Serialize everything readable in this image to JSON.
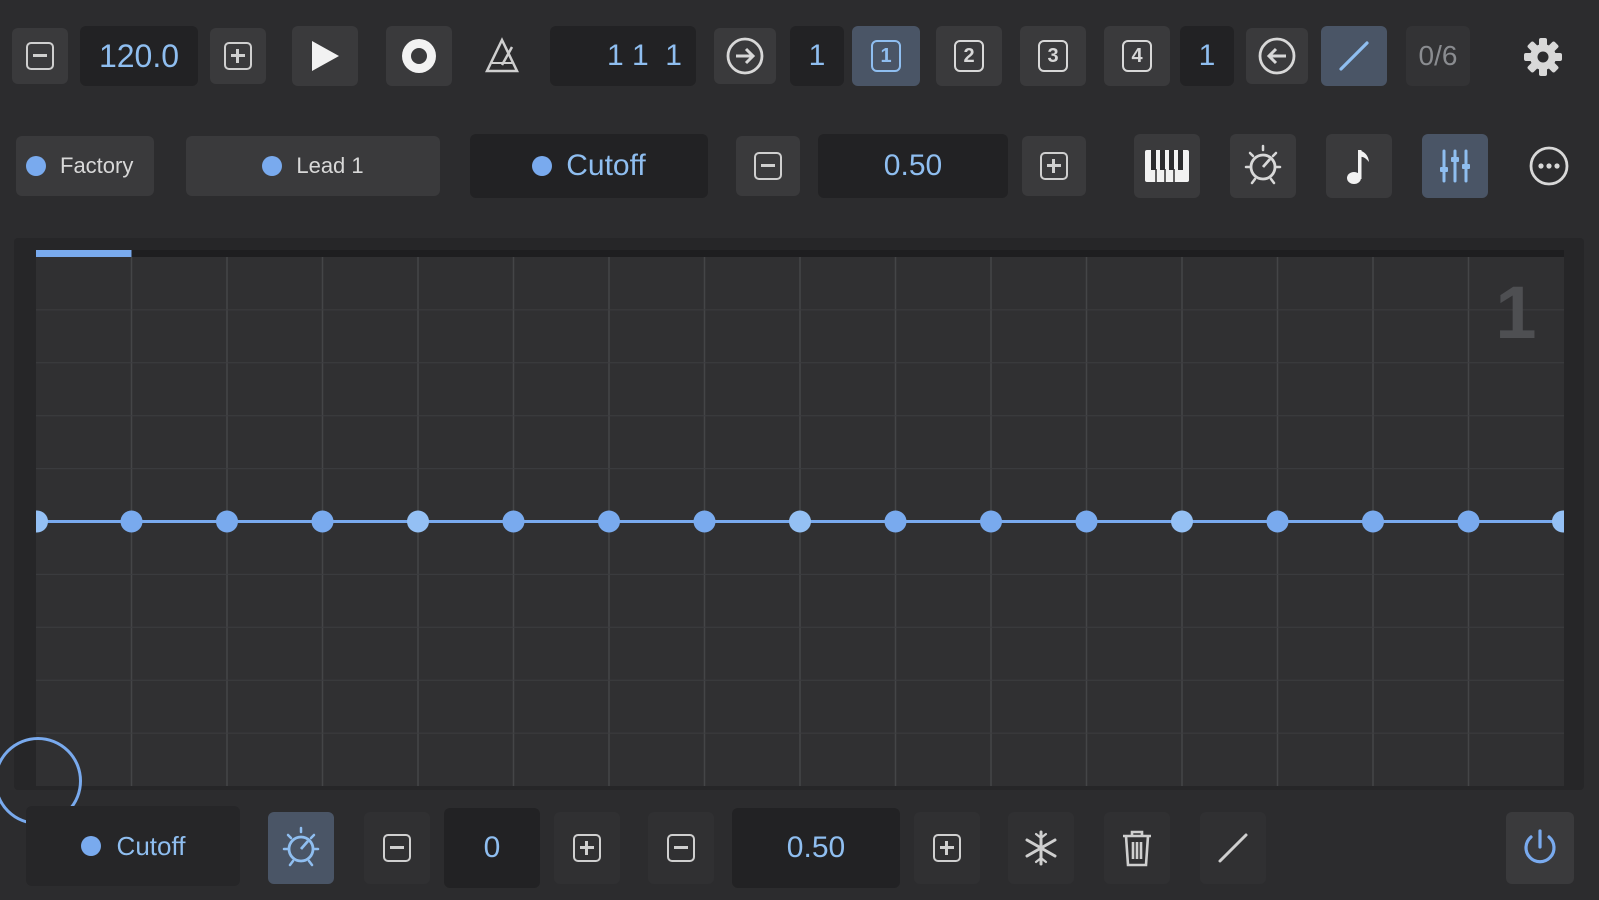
{
  "transport": {
    "tempo": "120.0",
    "position": "1 1  1",
    "loop_start_value": "1",
    "loop_end_value": "1",
    "banks": [
      "1",
      "2",
      "3",
      "4"
    ],
    "pattern_counter": "0/6"
  },
  "selector": {
    "factory_label": "Factory",
    "preset_label": "Lead 1",
    "parameter_label": "Cutoff",
    "parameter_value": "0.50"
  },
  "grid": {
    "page_number": "1",
    "columns": 16,
    "rows": 10,
    "steps": 17,
    "step_value": 0.5,
    "playhead_step": 1
  },
  "bottom": {
    "parameter_label": "Cutoff",
    "offset_value": "0",
    "level_value": "0.50"
  },
  "colors": {
    "accent": "#79aaee",
    "value_text": "#8fbef0",
    "background": "#2c2c2e",
    "grid_bg": "#303032"
  }
}
